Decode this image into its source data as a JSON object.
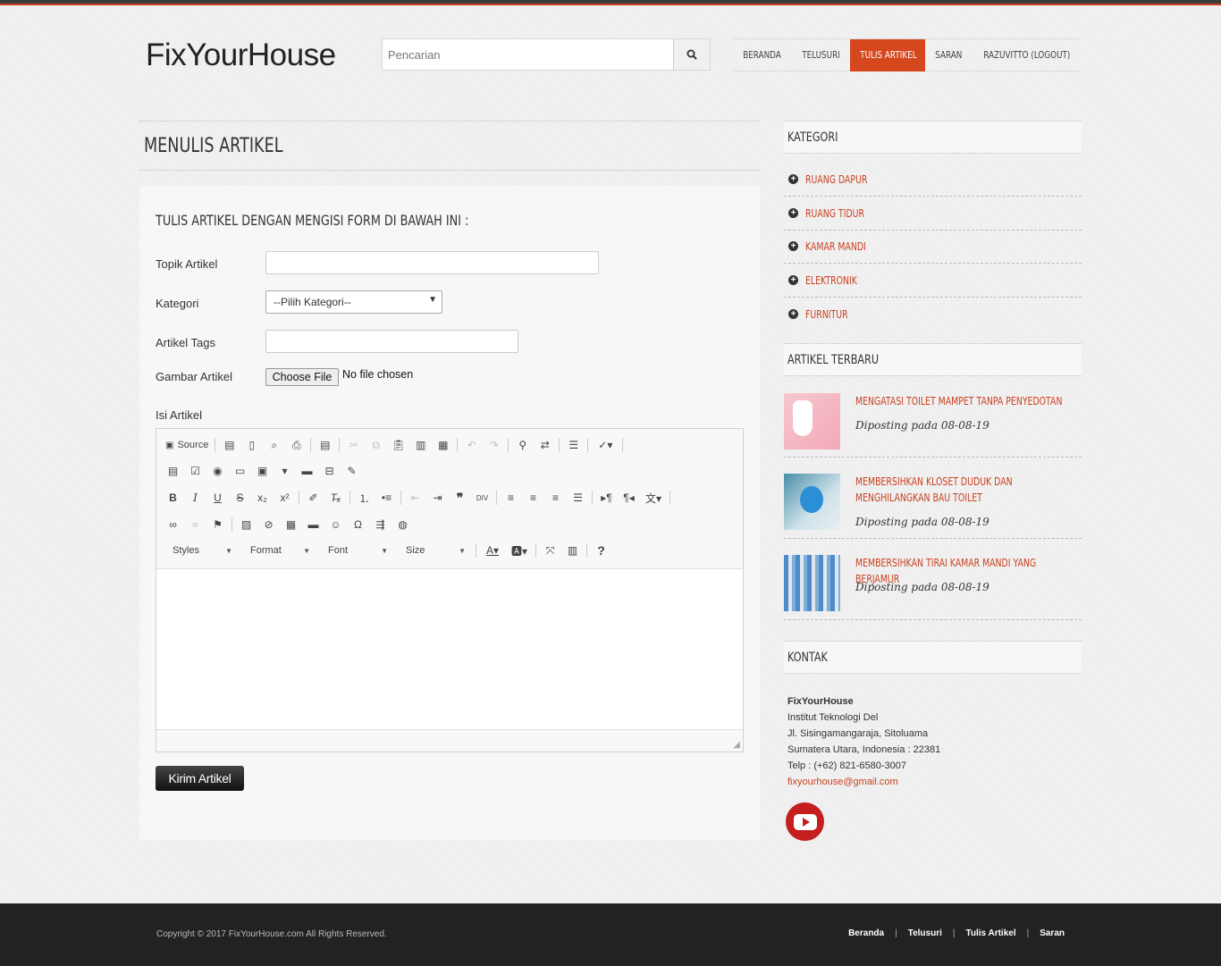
{
  "brand": {
    "logo": "FixYourHouse",
    "accent": "#d5471d"
  },
  "search": {
    "placeholder": "Pencarian",
    "icon": "search-icon"
  },
  "nav": {
    "items": [
      {
        "label": "BERANDA",
        "active": false
      },
      {
        "label": "TELUSURI",
        "active": false
      },
      {
        "label": "TULIS ARTIKEL",
        "active": true
      },
      {
        "label": "SARAN",
        "active": false
      },
      {
        "label": "RAZUVITTO (LOGOUT)",
        "active": false
      }
    ]
  },
  "main": {
    "title": "MENULIS ARTIKEL",
    "form": {
      "heading": "TULIS ARTIKEL DENGAN MENGISI FORM DI BAWAH INI :",
      "topik_label": "Topik Artikel",
      "topik_value": "",
      "kategori_label": "Kategori",
      "kategori_selected": "--Pilih Kategori--",
      "tags_label": "Artikel Tags",
      "tags_value": "",
      "gambar_label": "Gambar Artikel",
      "file_button": "Choose File",
      "file_status": "No file chosen",
      "isi_label": "Isi Artikel",
      "submit": "Kirim Artikel"
    },
    "editor": {
      "source_label": "Source",
      "styles": "Styles",
      "format": "Format",
      "font": "Font",
      "size": "Size"
    }
  },
  "sidebar": {
    "kategori_title": "KATEGORI",
    "categories": [
      "RUANG DAPUR",
      "RUANG TIDUR",
      "KAMAR MANDI",
      "ELEKTRONIK",
      "FURNITUR"
    ],
    "recent_title": "ARTIKEL TERBARU",
    "posts": [
      {
        "title": "MENGATASI TOILET MAMPET TANPA PENYEDOTAN",
        "date": "Diposting pada 08-08-19"
      },
      {
        "title": "MEMBERSIHKAN KLOSET DUDUK DAN MENGHILANGKAN BAU TOILET",
        "date": "Diposting pada 08-08-19"
      },
      {
        "title": "MEMBERSIHKAN TIRAI KAMAR MANDI YANG BERJAMUR",
        "date": "Diposting pada 08-08-19"
      }
    ],
    "kontak_title": "KONTAK",
    "contact": {
      "name": "FixYourHouse",
      "org": "Institut Teknologi Del",
      "street": "Jl. Sisingamangaraja, Sitoluama",
      "region": "Sumatera Utara, Indonesia : 22381",
      "phone": "Telp : (+62) 821-6580-3007",
      "email": "fixyourhouse@gmail.com"
    }
  },
  "footer": {
    "copyright": "Copyright © 2017 FixYourHouse.com All Rights Reserved.",
    "links": [
      "Beranda",
      "Telusuri",
      "Tulis Artikel",
      "Saran"
    ]
  }
}
